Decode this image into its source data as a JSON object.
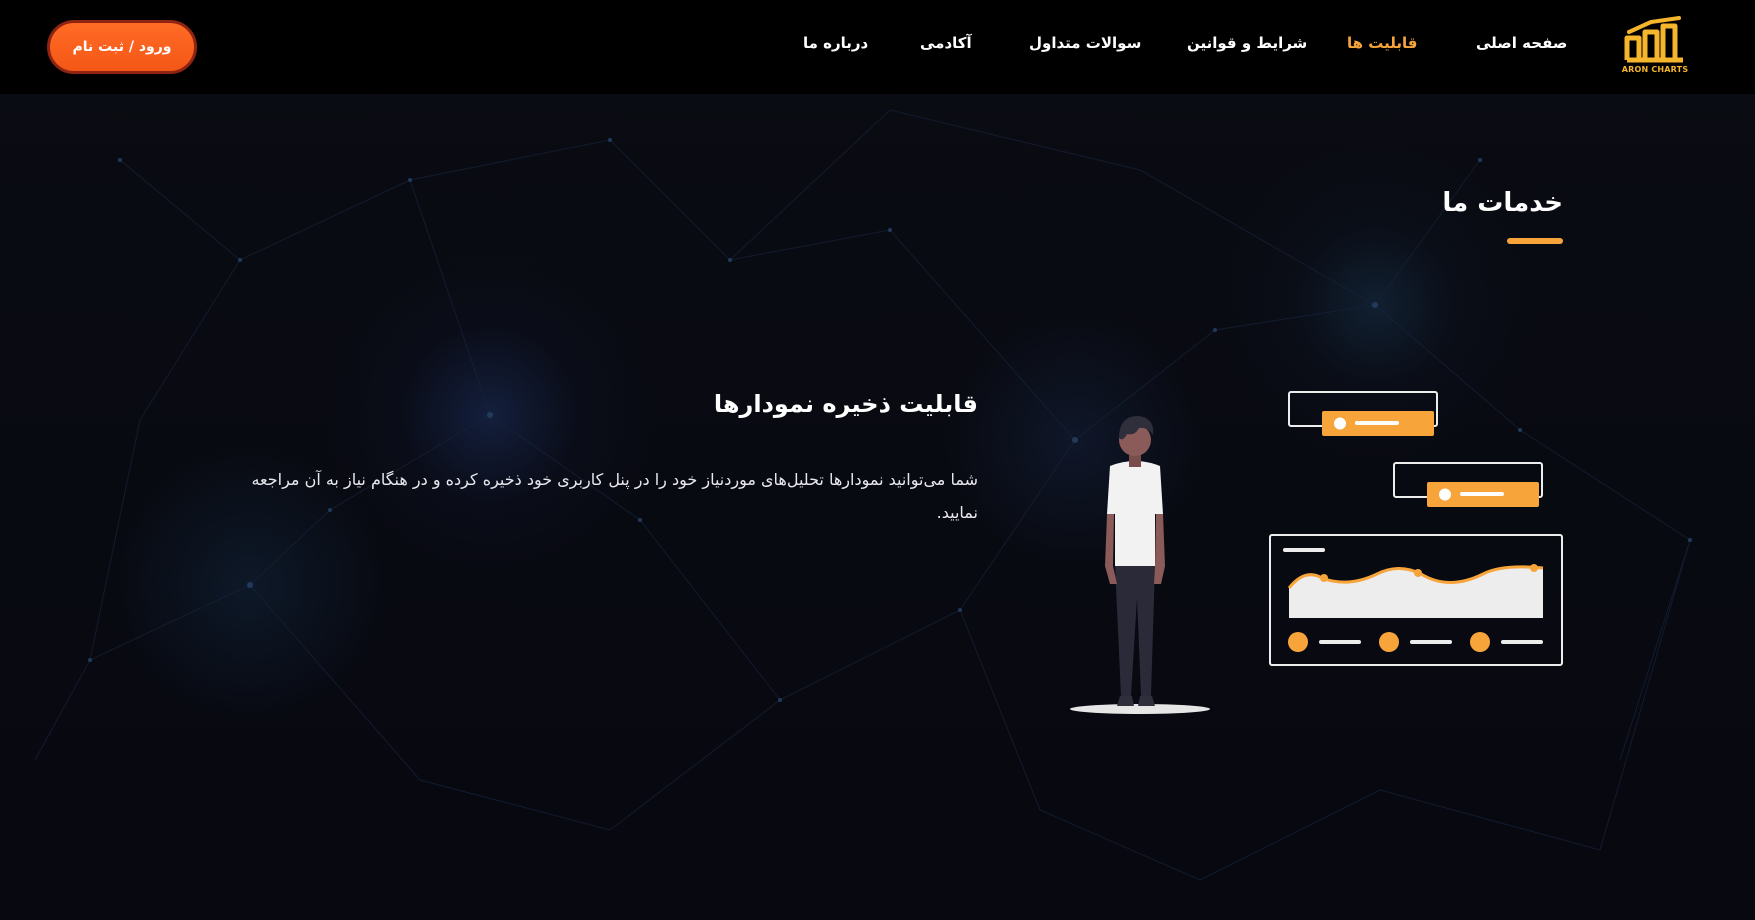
{
  "brand": {
    "logo_text": "ARON CHARTS",
    "accent_color": "#f7a53a",
    "logo_color": "#f5b52d",
    "button_color": "#f45717"
  },
  "nav": {
    "items": [
      {
        "label": "صفحه اصلی",
        "active": false
      },
      {
        "label": "قابلیت ها",
        "active": true
      },
      {
        "label": "شرایط و قوانین",
        "active": false
      },
      {
        "label": "سوالات متداول",
        "active": false
      },
      {
        "label": "آکادمی",
        "active": false
      },
      {
        "label": "درباره ما",
        "active": false
      }
    ],
    "login_label": "ورود / ثبت نام"
  },
  "section": {
    "title": "خدمات ما"
  },
  "feature": {
    "title": "قابلیت ذخیره نمودارها",
    "description": "شما می‌توانید نمودارها تحلیل‌های موردنیاز خود را در پنل کاربری خود ذخیره کرده و در هنگام نیاز به آن مراجعه نمایید."
  },
  "illustration": {
    "icons": [
      "person-figure",
      "saved-chart-card-icon",
      "chart-panel-icon"
    ]
  }
}
